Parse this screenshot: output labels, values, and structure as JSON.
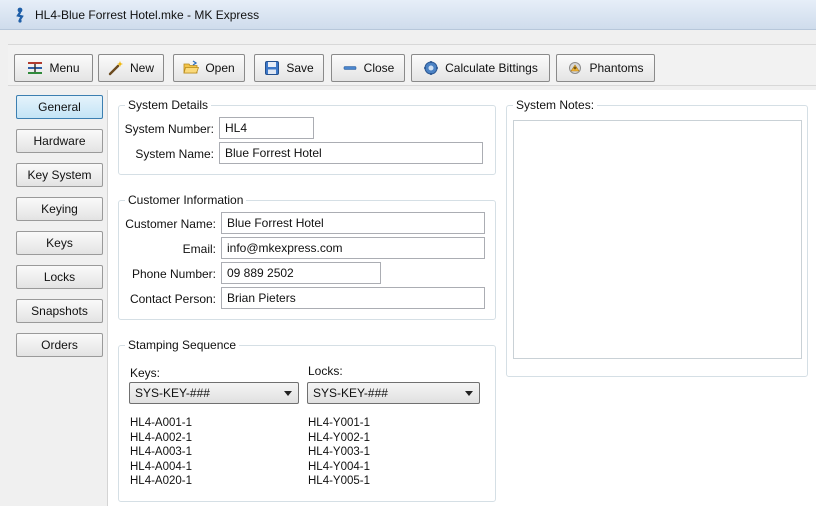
{
  "window": {
    "title": "HL4-Blue Forrest Hotel.mke - MK Express"
  },
  "toolbar": {
    "buttons": [
      {
        "label": "Menu",
        "icon": "menu-icon"
      },
      {
        "label": "New",
        "icon": "new-wand-icon"
      },
      {
        "label": "Open",
        "icon": "open-folder-icon"
      },
      {
        "label": "Save",
        "icon": "save-disk-icon"
      },
      {
        "label": "Close",
        "icon": "close-minus-icon"
      },
      {
        "label": "Calculate Bittings",
        "icon": "calculate-gear-icon"
      },
      {
        "label": "Phantoms",
        "icon": "phantoms-icon"
      }
    ]
  },
  "sidebar": {
    "items": [
      {
        "label": "General",
        "active": true
      },
      {
        "label": "Hardware"
      },
      {
        "label": "Key System"
      },
      {
        "label": "Keying"
      },
      {
        "label": "Keys"
      },
      {
        "label": "Locks"
      },
      {
        "label": "Snapshots"
      },
      {
        "label": "Orders"
      }
    ]
  },
  "system_details": {
    "legend": "System Details",
    "number_label": "System Number:",
    "number_value": "HL4",
    "name_label": "System Name:",
    "name_value": "Blue Forrest Hotel"
  },
  "customer": {
    "legend": "Customer Information",
    "name_label": "Customer Name:",
    "name_value": "Blue Forrest Hotel",
    "email_label": "Email:",
    "email_value": "info@mkexpress.com",
    "phone_label": "Phone Number:",
    "phone_value": "09 889 2502",
    "contact_label": "Contact Person:",
    "contact_value": "Brian Pieters"
  },
  "stamping": {
    "legend": "Stamping Sequence",
    "keys_label": "Keys:",
    "keys_value": "SYS-KEY-###",
    "locks_label": "Locks:",
    "locks_value": "SYS-KEY-###",
    "keys_list": [
      "HL4-A001-1",
      "HL4-A002-1",
      "HL4-A003-1",
      "HL4-A004-1",
      "HL4-A020-1"
    ],
    "locks_list": [
      "HL4-Y001-1",
      "HL4-Y002-1",
      "HL4-Y003-1",
      "HL4-Y004-1",
      "HL4-Y005-1"
    ]
  },
  "notes": {
    "legend": "System Notes:"
  },
  "colors": {
    "accent": "#3c7fb1",
    "active_nav": "#c4e4f6",
    "title_bar": "#cfdcec"
  }
}
